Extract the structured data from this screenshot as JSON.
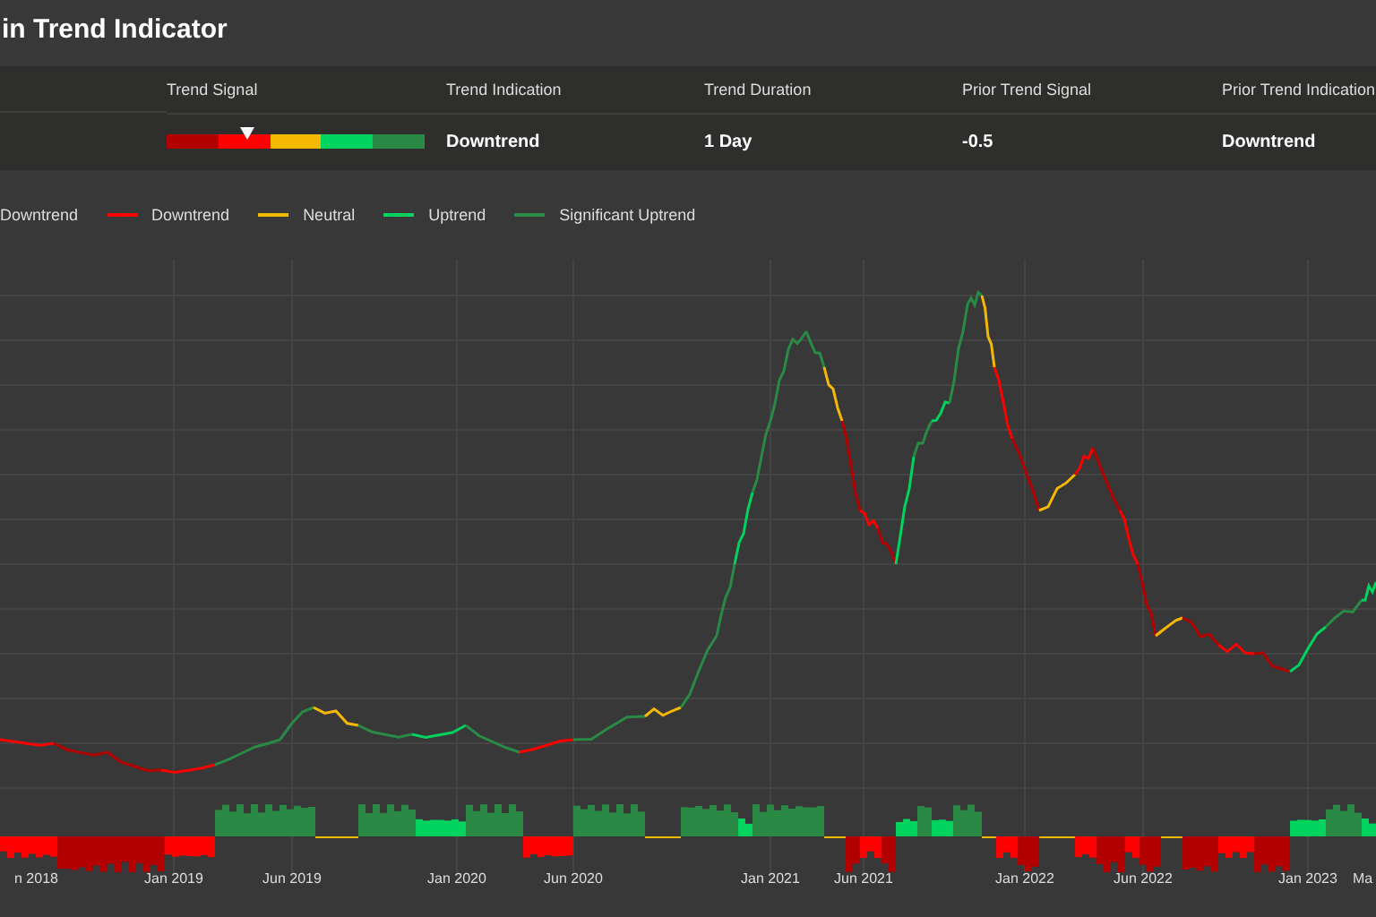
{
  "title": "in Trend Indicator",
  "summary": {
    "columns": [
      {
        "label": "Trend Signal",
        "kind": "scale"
      },
      {
        "label": "Trend Indication",
        "kind": "text",
        "value": "Downtrend"
      },
      {
        "label": "Trend Duration",
        "kind": "text",
        "value": "1 Day"
      },
      {
        "label": "Prior Trend Signal",
        "kind": "text",
        "value": "-0.5"
      },
      {
        "label": "Prior Trend Indication",
        "kind": "text",
        "value": "Downtrend"
      }
    ],
    "scale": {
      "segments": [
        {
          "color": "#b30000"
        },
        {
          "color": "#ff0000"
        },
        {
          "color": "#f5b800"
        },
        {
          "color": "#00d45f"
        },
        {
          "color": "#2a8a45"
        }
      ],
      "level": 0.31
    }
  },
  "legend": [
    {
      "label": "Downtrend"
    },
    {
      "label": "Downtrend",
      "color": "#ff0000"
    },
    {
      "label": "Neutral",
      "color": "#f5b800"
    },
    {
      "label": "Uptrend",
      "color": "#00d45f"
    },
    {
      "label": "Significant Uptrend",
      "color": "#2a8a45"
    }
  ],
  "x_axis_labels": [
    "n 2018",
    "Jan 2019",
    "Jun 2019",
    "Jan 2020",
    "Jun 2020",
    "Jan 2021",
    "Jun 2021",
    "Jan 2022",
    "Jun 2022",
    "Jan 2023",
    "Ma"
  ]
}
